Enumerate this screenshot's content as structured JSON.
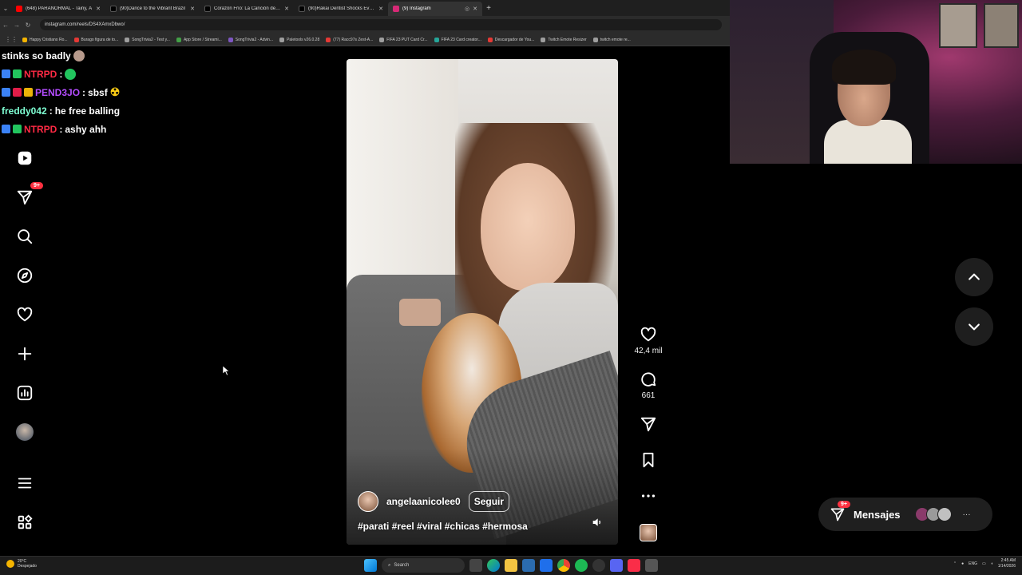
{
  "browser": {
    "tabs": [
      {
        "title": "(648) PARANORMAL - Tainy, Á",
        "color": "#ff0000",
        "active": false
      },
      {
        "title": "(90)Dance to the Vibrant Brazil",
        "color": "#000000",
        "active": false
      },
      {
        "title": "Corazón Frío: La Canción de un",
        "color": "#000000",
        "active": false
      },
      {
        "title": "(90)Rakai Dentist Shocks Every",
        "color": "#000000",
        "active": false
      },
      {
        "title": "(9) Instagram",
        "color": "#d62976",
        "active": true
      }
    ],
    "url": "instagram.com/reels/DS4XAmxDbwo/",
    "bookmarks": [
      {
        "label": "Happy Cristiano Ro...",
        "color": "#f4b400"
      },
      {
        "label": "Burago figura de to...",
        "color": "#e53935"
      },
      {
        "label": "SongTrivia2 - Test y...",
        "color": "#9e9e9e"
      },
      {
        "label": "App Store / Streami...",
        "color": "#43a047"
      },
      {
        "label": "SongTrivia2 - Advin...",
        "color": "#7e57c2"
      },
      {
        "label": "Paletools v26.0.28",
        "color": "#9e9e9e"
      },
      {
        "label": "(77) Racc97s Zest-A...",
        "color": "#e53935"
      },
      {
        "label": "FIFA 23 PUT Card Cr...",
        "color": "#9e9e9e"
      },
      {
        "label": "FIFA 23 Card creator...",
        "color": "#26a69a"
      },
      {
        "label": "Descargador de You...",
        "color": "#e53935"
      },
      {
        "label": "Twitch Emote Resizer",
        "color": "#9e9e9e"
      },
      {
        "label": "twitch emote re...",
        "color": "#9e9e9e"
      }
    ]
  },
  "chat": [
    {
      "user": "",
      "message": "stinks so badly",
      "user_color": "#ffffff",
      "badges": []
    },
    {
      "user": "NTRPD",
      "message": "",
      "user_color": "#ff2a44",
      "badges": [
        "#3b82f6",
        "#22c55e"
      ]
    },
    {
      "user": "PEND3JO",
      "message": "sbsf",
      "user_color": "#b44dff",
      "badges": [
        "#3b82f6",
        "#e11d48",
        "#eab308"
      ]
    },
    {
      "user": "freddy042",
      "message": "he free balling",
      "user_color": "#7fffd4",
      "badges": []
    },
    {
      "user": "NTRPD",
      "message": "ashy ahh",
      "user_color": "#ff2a44",
      "badges": [
        "#3b82f6",
        "#22c55e"
      ]
    }
  ],
  "sidebar": {
    "items": [
      {
        "name": "reels",
        "icon": "play-icon"
      },
      {
        "name": "messages",
        "icon": "send-icon",
        "badge": "9+"
      },
      {
        "name": "search",
        "icon": "search-icon"
      },
      {
        "name": "explore",
        "icon": "compass-icon"
      },
      {
        "name": "notifications",
        "icon": "heart-icon"
      },
      {
        "name": "create",
        "icon": "plus-icon"
      },
      {
        "name": "dashboard",
        "icon": "chart-icon"
      },
      {
        "name": "profile",
        "icon": "avatar"
      },
      {
        "name": "more",
        "icon": "menu-icon"
      },
      {
        "name": "apps",
        "icon": "apps-icon"
      }
    ]
  },
  "reel": {
    "author": "angelaanicolee0",
    "follow_label": "Seguir",
    "caption": "#parati #reel #viral #chicas #hermosa",
    "likes": "42,4 mil",
    "comments": "661"
  },
  "messages": {
    "label": "Mensajes",
    "badge": "9+"
  },
  "taskbar": {
    "weather_temp": "20°C",
    "weather_text": "Despejado",
    "search_placeholder": "Search",
    "lang": "ENG",
    "time": "2:45 AM",
    "date": "1/14/2026"
  },
  "colors": {
    "accent": "#ff3040",
    "background": "#000000"
  }
}
